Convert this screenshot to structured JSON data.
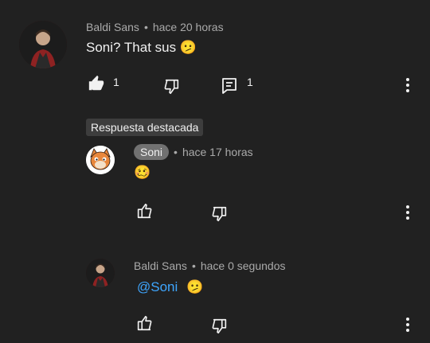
{
  "comment": {
    "author": "Baldi Sans",
    "separator": "•",
    "time": "hace 20 horas",
    "text": "Soni? That sus",
    "emoji": "🫤",
    "like_count": "1",
    "reply_count": "1"
  },
  "featured_label": "Respuesta destacada",
  "reply1": {
    "author": "Soni",
    "separator": "•",
    "time": "hace 17 horas",
    "emoji": "🥴"
  },
  "reply2": {
    "author": "Baldi Sans",
    "separator": "•",
    "time": "hace 0 segundos",
    "mention": "@Soni",
    "emoji": "🫤"
  },
  "colors": {
    "background": "#212121",
    "text": "#f1f1f1",
    "meta": "#aaaaaa",
    "mention": "#3ea6ff",
    "chip": "#717171"
  }
}
